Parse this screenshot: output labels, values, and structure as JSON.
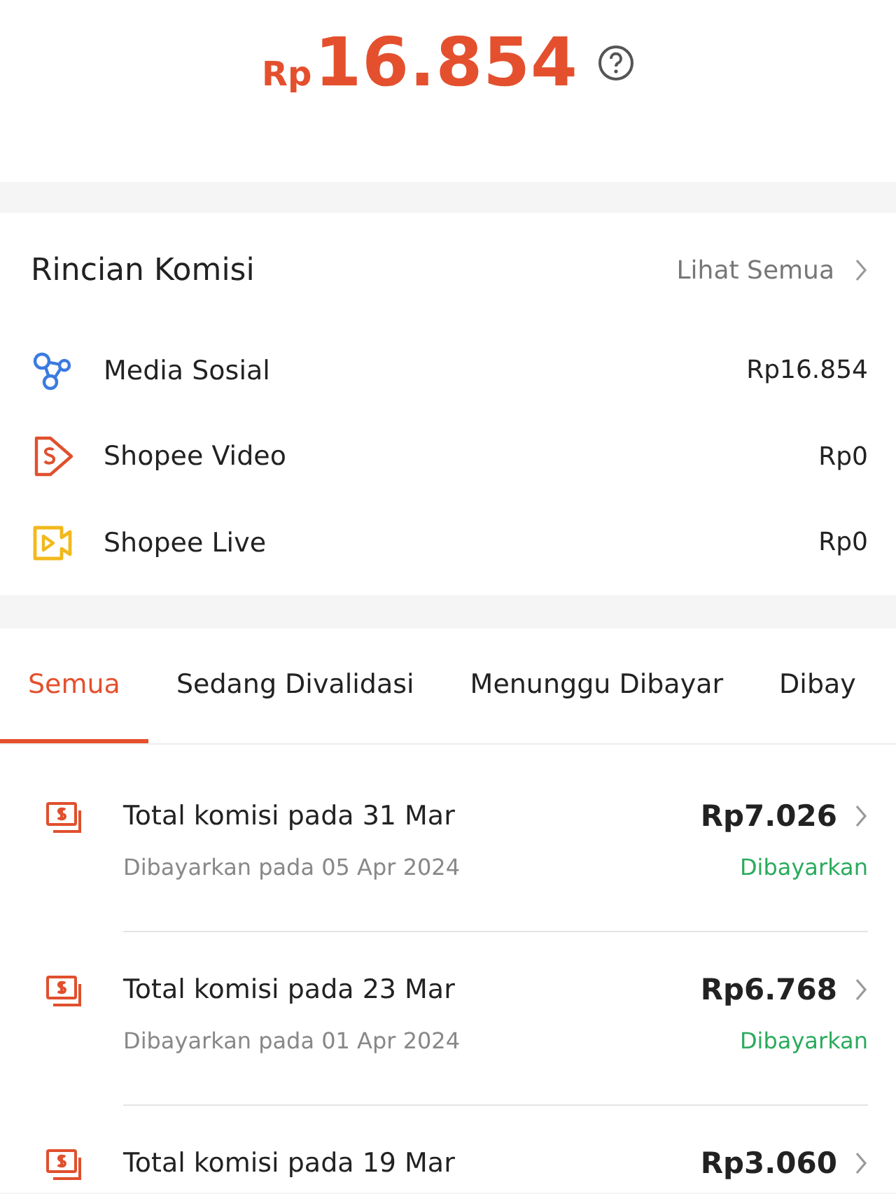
{
  "balance": {
    "currency": "Rp",
    "amount": "16.854"
  },
  "breakdown": {
    "title": "Rincian Komisi",
    "link": "Lihat Semua",
    "items": [
      {
        "kind": "social",
        "label": "Media Sosial",
        "amount": "Rp16.854"
      },
      {
        "kind": "video",
        "label": "Shopee Video",
        "amount": "Rp0"
      },
      {
        "kind": "live",
        "label": "Shopee Live",
        "amount": "Rp0"
      }
    ]
  },
  "tabs": [
    {
      "label": "Semua",
      "selected": true
    },
    {
      "label": "Sedang Divalidasi",
      "selected": false
    },
    {
      "label": "Menunggu Dibayar",
      "selected": false
    },
    {
      "label": "Dibay",
      "selected": false
    }
  ],
  "payouts": [
    {
      "title": "Total komisi pada 31 Mar",
      "amount": "Rp7.026",
      "paid_on": "Dibayarkan pada 05 Apr 2024",
      "status": "Dibayarkan"
    },
    {
      "title": "Total komisi pada 23 Mar",
      "amount": "Rp6.768",
      "paid_on": "Dibayarkan pada 01 Apr 2024",
      "status": "Dibayarkan"
    },
    {
      "title": "Total komisi pada 19 Mar",
      "amount": "Rp3.060"
    }
  ]
}
